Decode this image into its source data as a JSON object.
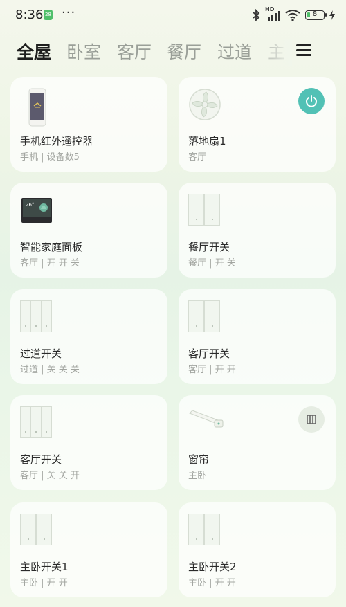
{
  "status_bar": {
    "time": "8:36",
    "calendar_day": "28",
    "dots": "···",
    "network_label": "HD",
    "battery_level": "8"
  },
  "tabs": [
    {
      "label": "全屋",
      "active": true
    },
    {
      "label": "卧室",
      "active": false
    },
    {
      "label": "客厅",
      "active": false
    },
    {
      "label": "餐厅",
      "active": false
    },
    {
      "label": "过道",
      "active": false
    },
    {
      "label": "主",
      "active": false
    }
  ],
  "devices": [
    {
      "name": "手机红外遥控器",
      "sub": "手机 | 设备数5",
      "icon": "phone-remote-icon"
    },
    {
      "name": "落地扇1",
      "sub": "客厅",
      "icon": "fan-icon",
      "action": "power-icon"
    },
    {
      "name": "智能家庭面板",
      "sub": "客厅 | 开 开 关",
      "icon": "home-panel-icon",
      "panel_temp": "26°"
    },
    {
      "name": "餐厅开关",
      "sub": "餐厅 | 开 关",
      "icon": "switch-icon"
    },
    {
      "name": "过道开关",
      "sub": "过道 | 关 关 关",
      "icon": "switch-icon"
    },
    {
      "name": "客厅开关",
      "sub": "客厅 | 开 开",
      "icon": "switch-icon"
    },
    {
      "name": "客厅开关",
      "sub": "客厅 | 关 关 开",
      "icon": "switch-icon"
    },
    {
      "name": "窗帘",
      "sub": "主卧",
      "icon": "curtain-icon",
      "action": "pause-icon"
    },
    {
      "name": "主卧开关1",
      "sub": "主卧 | 开 开",
      "icon": "switch-icon"
    },
    {
      "name": "主卧开关2",
      "sub": "主卧 | 开 开",
      "icon": "switch-icon"
    }
  ],
  "colors": {
    "accent": "#52c1b5",
    "text_primary": "#2a2a2a",
    "text_secondary": "#a3a6a1"
  }
}
